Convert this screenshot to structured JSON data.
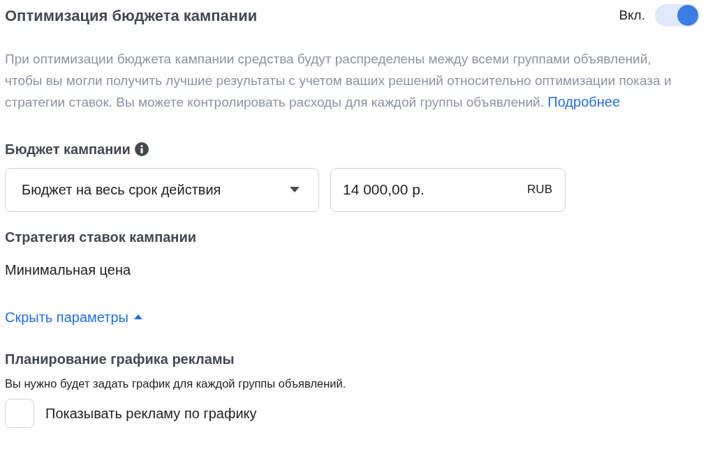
{
  "header": {
    "title": "Оптимизация бюджета кампании",
    "toggle_label": "Вкл.",
    "toggle_on": true
  },
  "description": {
    "text": "При оптимизации бюджета кампании средства будут распределены между всеми группами объявлений, чтобы вы могли получить лучшие результаты с учетом ваших решений относительно оптимизации показа и стратегии ставок. Вы можете контролировать расходы для каждой группы объявлений.",
    "link": "Подробнее"
  },
  "budget": {
    "label": "Бюджет кампании",
    "type_dropdown": "Бюджет на весь срок действия",
    "amount": "14 000,00 р.",
    "currency": "RUB"
  },
  "bid_strategy": {
    "label": "Стратегия ставок кампании",
    "value": "Минимальная цена"
  },
  "options_link": {
    "label": "Скрыть параметры",
    "expanded": true
  },
  "schedule": {
    "title": "Планирование графика рекламы",
    "hint": "Вы нужно будет задать график для каждой группы объявлений.",
    "checkbox_label": "Показывать рекламу по графику",
    "checked": false
  }
}
